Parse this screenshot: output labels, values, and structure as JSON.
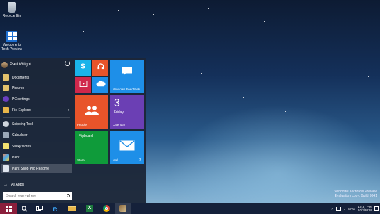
{
  "desktop": {
    "icons": [
      {
        "label": "Recycle Bin"
      },
      {
        "label": "Welcome to Tech Preview"
      }
    ],
    "watermark": {
      "line1": "Windows Technical Preview",
      "line2": "Evaluation copy. Build 9841"
    }
  },
  "start_menu": {
    "user_name": "Paul Wright",
    "places": [
      {
        "label": "Documents"
      },
      {
        "label": "Pictures"
      },
      {
        "label": "PC settings"
      },
      {
        "label": "File Explorer",
        "arrow": "›"
      }
    ],
    "apps": [
      {
        "label": "Snipping Tool"
      },
      {
        "label": "Calculator"
      },
      {
        "label": "Sticky Notes"
      },
      {
        "label": "Paint"
      },
      {
        "label": "Paint Shop Pro Readme"
      }
    ],
    "all_apps": {
      "label": "All Apps",
      "arrow": "→"
    },
    "search": {
      "placeholder": "Search everywhere"
    },
    "tiles": {
      "windows_feedback": {
        "label": "Windows Feedback"
      },
      "people": {
        "label": "People"
      },
      "calendar": {
        "label": "Calendar",
        "number": "3",
        "day": "Friday"
      },
      "flipboard": {
        "label": "Flipboard"
      },
      "store": {
        "label": "Store"
      },
      "mail": {
        "label": "Mail",
        "count": "9"
      }
    }
  },
  "taskbar": {
    "tray": {
      "language": "ENG",
      "time": "10:37 PM",
      "date": "10/3/2014"
    }
  },
  "colors": {
    "start_button": "#8b1f3c",
    "tile_blue": "#1e8fe8",
    "tile_orange": "#e8542a",
    "tile_red": "#d0274b",
    "tile_purple": "#6b3fb4",
    "tile_green": "#0f9b3a",
    "tile_skype": "#1ab3ea"
  }
}
